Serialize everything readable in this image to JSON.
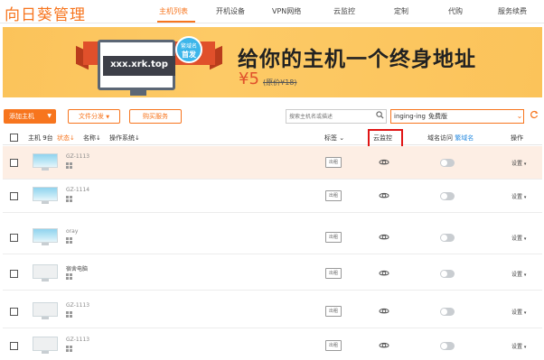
{
  "header": {
    "logo": "向日葵管理",
    "nav": [
      "主机列表",
      "开机设备",
      "VPN网络",
      "云监控",
      "定制",
      "代购",
      "服务续费"
    ]
  },
  "banner": {
    "domain_text": "xxx.xrk.top",
    "badge_line1": "繁域名",
    "badge_line2": "首发",
    "slogan": "给你的主机一个终身地址",
    "price": "¥5",
    "original_price": "(原价¥18)"
  },
  "toolbar": {
    "add_host": "添加主机",
    "file_share": "文件分发",
    "buy_service": "购买服务",
    "search_placeholder": "搜索主机名或描述",
    "account": "inging-ing",
    "account_level": "免费版"
  },
  "table": {
    "col_host": "主机 9台",
    "col_status": "状态",
    "col_name": "名称",
    "col_os": "操作系统",
    "col_tag": "标签",
    "col_cloud": "云监控",
    "col_domain": "域名访问",
    "col_domain_link": "繁域名",
    "col_action": "操作",
    "rows": [
      {
        "name": "GZ-1113",
        "tag": "出租",
        "action": "设置",
        "thumb": "sky"
      },
      {
        "name": "GZ-1114",
        "tag": "出租",
        "action": "设置",
        "thumb": "sky"
      },
      {
        "name": "oray",
        "tag": "出租",
        "action": "设置",
        "thumb": "sky"
      },
      {
        "name": "宿舍电脑",
        "tag": "出租",
        "action": "设置",
        "thumb": "blank"
      },
      {
        "name": "GZ-1113",
        "tag": "出租",
        "action": "设置",
        "thumb": "blank"
      },
      {
        "name": "GZ-1113",
        "tag": "出租",
        "action": "设置",
        "thumb": "blank"
      }
    ]
  },
  "colors": {
    "accent": "#f7751e",
    "banner_bg": "#fbc35a",
    "highlight": "#e01515",
    "link": "#2a8ce0"
  }
}
